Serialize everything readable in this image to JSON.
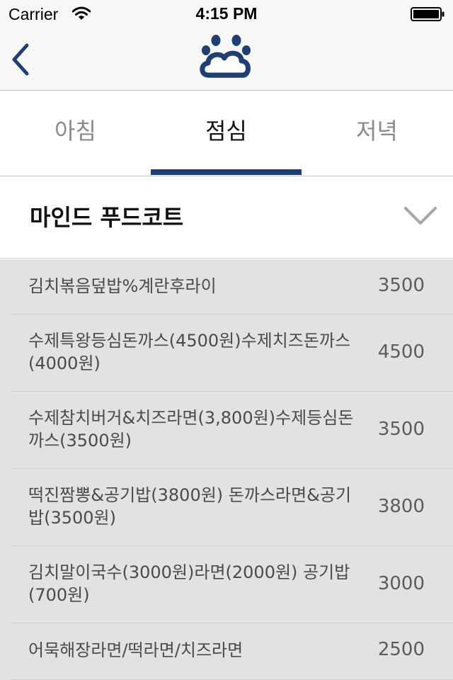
{
  "status_bar": {
    "carrier": "Carrier",
    "time": "4:15 PM"
  },
  "header": {
    "back_icon": "chevron-left-icon",
    "logo_icon": "paw-cloud-logo"
  },
  "tabs": [
    {
      "label": "아침",
      "active": false
    },
    {
      "label": "점심",
      "active": true
    },
    {
      "label": "저녁",
      "active": false
    }
  ],
  "section": {
    "title": "마인드 푸드코트",
    "expand_icon": "chevron-down-icon"
  },
  "menu": [
    {
      "name": "김치볶음덮밥%계란후라이",
      "price": "3500"
    },
    {
      "name": "수제특왕등심돈까스(4500원)수제치즈돈까스(4000원)",
      "price": "4500"
    },
    {
      "name": "수제참치버거&치즈라면(3,800원)수제등심돈까스(3500원)",
      "price": "3500"
    },
    {
      "name": "떡진짬뽕&공기밥(3800원) 돈까스라면&공기밥(3500원)",
      "price": "3800"
    },
    {
      "name": "김치말이국수(3000원)라면(2000원) 공기밥(700원)",
      "price": "3000"
    },
    {
      "name": "어묵해장라면/떡라면/치즈라면",
      "price": "2500"
    }
  ],
  "colors": {
    "accent": "#1f3f73",
    "list_background": "#e2e2e2",
    "nav_background": "#f7f7f7"
  }
}
